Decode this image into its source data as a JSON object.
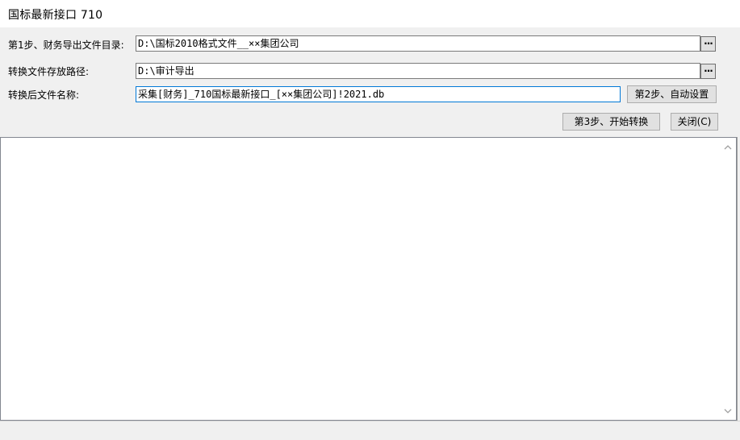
{
  "window": {
    "title": "国标最新接口 710"
  },
  "form": {
    "step1_label": "第1步、财务导出文件目录:",
    "step1_value": "D:\\国标2010格式文件__××集团公司",
    "output_dir_label": "转换文件存放路径:",
    "output_dir_value": "D:\\审计导出",
    "filename_label": "转换后文件名称:",
    "filename_value": "采集[财务]_710国标最新接口_[××集团公司]!2021.db",
    "browse_label": "...",
    "step2_button": "第2步、自动设置",
    "step3_button": "第3步、开始转换",
    "close_button": "关闭(C)"
  },
  "output": {
    "log_text": ""
  },
  "icons": {
    "scroll_up": "chevron-up-icon",
    "scroll_down": "chevron-down-icon"
  }
}
